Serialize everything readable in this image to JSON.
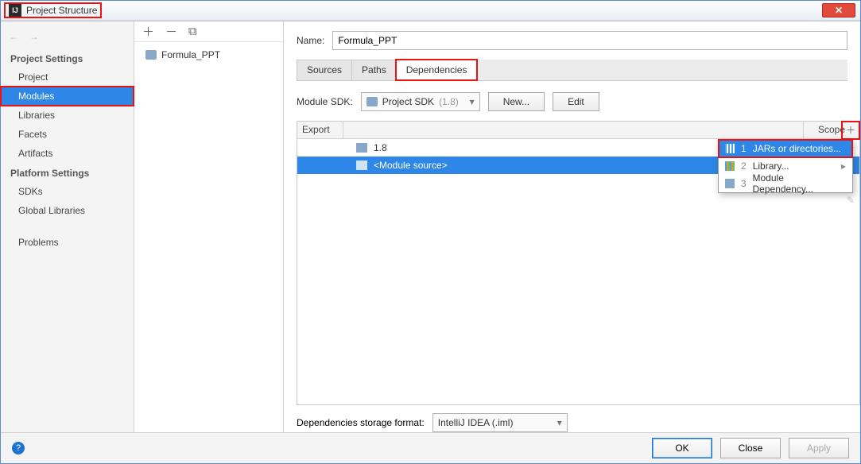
{
  "window": {
    "title": "Project Structure"
  },
  "sidebar": {
    "sections": [
      {
        "title": "Project Settings",
        "items": [
          "Project",
          "Modules",
          "Libraries",
          "Facets",
          "Artifacts"
        ],
        "selected": 1
      },
      {
        "title": "Platform Settings",
        "items": [
          "SDKs",
          "Global Libraries"
        ]
      }
    ],
    "extra": [
      "Problems"
    ]
  },
  "tree": {
    "module_name": "Formula_PPT"
  },
  "form": {
    "name_label": "Name:",
    "name_value": "Formula_PPT",
    "tabs": [
      "Sources",
      "Paths",
      "Dependencies"
    ],
    "active_tab": 2,
    "sdk_label": "Module SDK:",
    "sdk_value": "Project SDK",
    "sdk_hint": "(1.8)",
    "new_btn": "New...",
    "edit_btn": "Edit",
    "deps_header": {
      "export": "Export",
      "scope": "Scope"
    },
    "deps": [
      {
        "label": "1.8",
        "selected": false
      },
      {
        "label": "<Module source>",
        "selected": true
      }
    ],
    "popup": [
      {
        "n": "1",
        "label": "JARs or directories...",
        "selected": true
      },
      {
        "n": "2",
        "label": "Library...",
        "has_sub": true
      },
      {
        "n": "3",
        "label": "Module Dependency..."
      }
    ],
    "storage_label": "Dependencies storage format:",
    "storage_value": "IntelliJ IDEA (.iml)"
  },
  "footer": {
    "ok": "OK",
    "cancel": "Close",
    "apply": "Apply"
  }
}
